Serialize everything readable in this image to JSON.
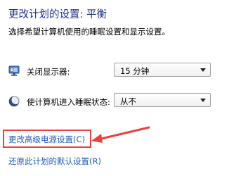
{
  "header": {
    "title": "更改计划的设置: 平衡",
    "subtitle": "选择希望计算机使用的睡眠设置和显示设置。"
  },
  "settings": [
    {
      "label": "关闭显示器:",
      "icon": "monitor-icon",
      "value": "15 分钟"
    },
    {
      "label": "使计算机进入睡眠状态:",
      "icon": "moon-icon",
      "value": "从不"
    }
  ],
  "links": {
    "advanced": "更改高级电源设置(C)",
    "restore": "还原此计划的默认设置(R)"
  },
  "colors": {
    "title": "#1e3287",
    "link": "#1f5bb8",
    "annotation": "#e8433a"
  }
}
